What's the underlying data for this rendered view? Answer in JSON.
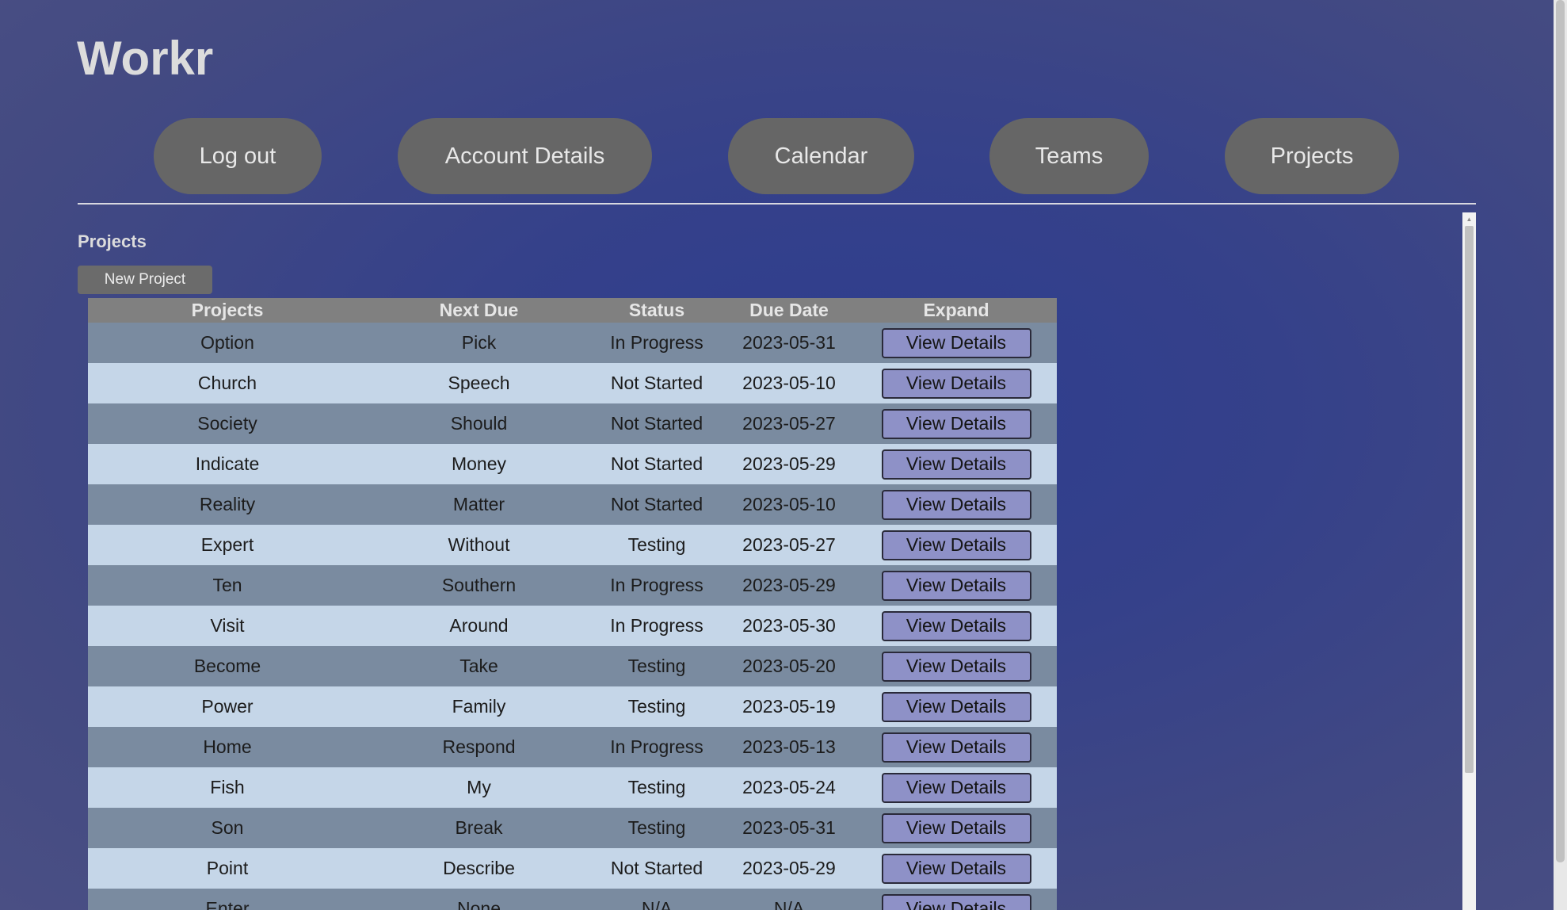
{
  "app": {
    "title": "Workr"
  },
  "nav": {
    "items": [
      {
        "label": "Log out"
      },
      {
        "label": "Account Details"
      },
      {
        "label": "Calendar"
      },
      {
        "label": "Teams"
      },
      {
        "label": "Projects"
      }
    ]
  },
  "main": {
    "section_title": "Projects",
    "new_project_label": "New Project",
    "table": {
      "headers": [
        "Projects",
        "Next Due",
        "Status",
        "Due Date",
        "Expand"
      ],
      "rows": [
        {
          "project": "Option",
          "next_due": "Pick",
          "status": "In Progress",
          "due_date": "2023-05-31",
          "expand_label": "View Details"
        },
        {
          "project": "Church",
          "next_due": "Speech",
          "status": "Not Started",
          "due_date": "2023-05-10",
          "expand_label": "View Details"
        },
        {
          "project": "Society",
          "next_due": "Should",
          "status": "Not Started",
          "due_date": "2023-05-27",
          "expand_label": "View Details"
        },
        {
          "project": "Indicate",
          "next_due": "Money",
          "status": "Not Started",
          "due_date": "2023-05-29",
          "expand_label": "View Details"
        },
        {
          "project": "Reality",
          "next_due": "Matter",
          "status": "Not Started",
          "due_date": "2023-05-10",
          "expand_label": "View Details"
        },
        {
          "project": "Expert",
          "next_due": "Without",
          "status": "Testing",
          "due_date": "2023-05-27",
          "expand_label": "View Details"
        },
        {
          "project": "Ten",
          "next_due": "Southern",
          "status": "In Progress",
          "due_date": "2023-05-29",
          "expand_label": "View Details"
        },
        {
          "project": "Visit",
          "next_due": "Around",
          "status": "In Progress",
          "due_date": "2023-05-30",
          "expand_label": "View Details"
        },
        {
          "project": "Become",
          "next_due": "Take",
          "status": "Testing",
          "due_date": "2023-05-20",
          "expand_label": "View Details"
        },
        {
          "project": "Power",
          "next_due": "Family",
          "status": "Testing",
          "due_date": "2023-05-19",
          "expand_label": "View Details"
        },
        {
          "project": "Home",
          "next_due": "Respond",
          "status": "In Progress",
          "due_date": "2023-05-13",
          "expand_label": "View Details"
        },
        {
          "project": "Fish",
          "next_due": "My",
          "status": "Testing",
          "due_date": "2023-05-24",
          "expand_label": "View Details"
        },
        {
          "project": "Son",
          "next_due": "Break",
          "status": "Testing",
          "due_date": "2023-05-31",
          "expand_label": "View Details"
        },
        {
          "project": "Point",
          "next_due": "Describe",
          "status": "Not Started",
          "due_date": "2023-05-29",
          "expand_label": "View Details"
        },
        {
          "project": "Enter",
          "next_due": "None",
          "status": "N/A",
          "due_date": "N/A",
          "expand_label": "View Details"
        }
      ]
    }
  },
  "colors": {
    "background": "#35418a",
    "nav_button": "#666666",
    "header_row": "#808080",
    "row_odd": "#7a8ba0",
    "row_even": "#c5d6e8",
    "view_button": "#8e91c7"
  }
}
